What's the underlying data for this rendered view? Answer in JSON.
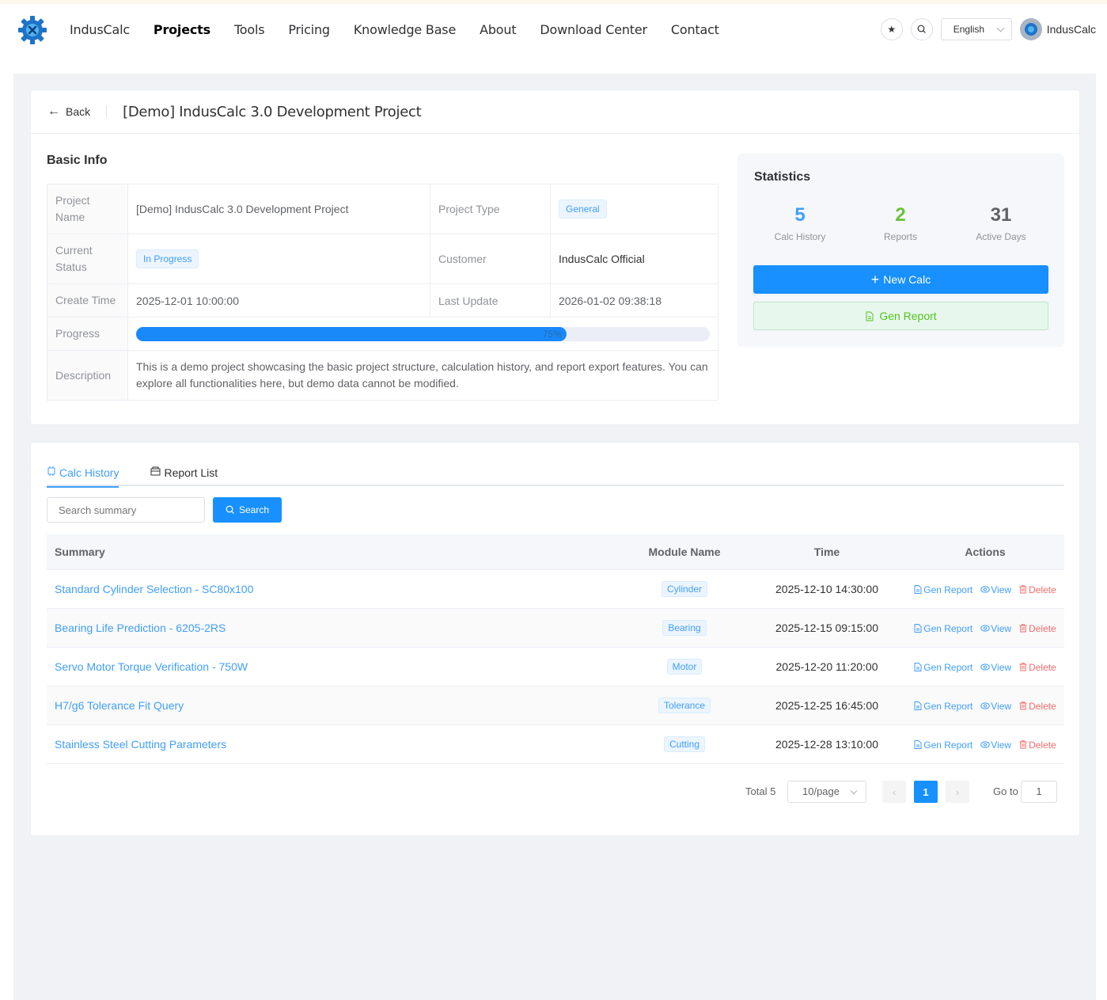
{
  "header": {
    "brand": "IndusCalc",
    "nav": [
      "IndusCalc",
      "Projects",
      "Tools",
      "Pricing",
      "Knowledge Base",
      "About",
      "Download Center",
      "Contact"
    ],
    "active_nav": "Projects",
    "language": "English",
    "user_name": "IndusCalc",
    "icons": [
      "star-icon",
      "search-icon"
    ]
  },
  "page": {
    "back_label": "Back",
    "title": "[Demo] IndusCalc 3.0 Development Project"
  },
  "basic_info": {
    "title": "Basic Info",
    "project_name_label": "Project Name",
    "project_name": "[Demo] IndusCalc 3.0 Development Project",
    "project_type_label": "Project Type",
    "project_type": "General",
    "status_label": "Current Status",
    "status": "In Progress",
    "customer_label": "Customer",
    "customer": "IndusCalc Official",
    "create_time_label": "Create Time",
    "create_time": "2025-12-01 10:00:00",
    "last_update_label": "Last Update",
    "last_update": "2026-01-02 09:38:18",
    "progress_label": "Progress",
    "progress_percent": 75,
    "progress_text": "75%",
    "description_label": "Description",
    "description": "This is a demo project showcasing the basic project structure, calculation history, and report export features. You can explore all functionalities here, but demo data cannot be modified."
  },
  "statistics": {
    "title": "Statistics",
    "items": [
      {
        "value": "5",
        "label": "Calc History",
        "color": "#409eff"
      },
      {
        "value": "2",
        "label": "Reports",
        "color": "#67c23a"
      },
      {
        "value": "31",
        "label": "Active Days",
        "color": "#606266"
      }
    ],
    "new_calc": "New Calc",
    "gen_report": "Gen Report"
  },
  "tabs": {
    "calc_history": "Calc History",
    "report_list": "Report List"
  },
  "search": {
    "placeholder": "Search summary",
    "button": "Search"
  },
  "table": {
    "headers": {
      "summary": "Summary",
      "module": "Module Name",
      "time": "Time",
      "actions": "Actions"
    },
    "action_labels": {
      "gen": "Gen Report",
      "view": "View",
      "delete": "Delete"
    },
    "rows": [
      {
        "summary": "Standard Cylinder Selection - SC80x100",
        "module": "Cylinder",
        "time": "2025-12-10 14:30:00"
      },
      {
        "summary": "Bearing Life Prediction - 6205-2RS",
        "module": "Bearing",
        "time": "2025-12-15 09:15:00"
      },
      {
        "summary": "Servo Motor Torque Verification - 750W",
        "module": "Motor",
        "time": "2025-12-20 11:20:00"
      },
      {
        "summary": "H7/g6 Tolerance Fit Query",
        "module": "Tolerance",
        "time": "2025-12-25 16:45:00"
      },
      {
        "summary": "Stainless Steel Cutting Parameters",
        "module": "Cutting",
        "time": "2025-12-28 13:10:00"
      }
    ]
  },
  "pagination": {
    "total": "Total 5",
    "page_size": "10/page",
    "current_page": "1",
    "goto_label": "Go to",
    "goto_value": "1"
  }
}
